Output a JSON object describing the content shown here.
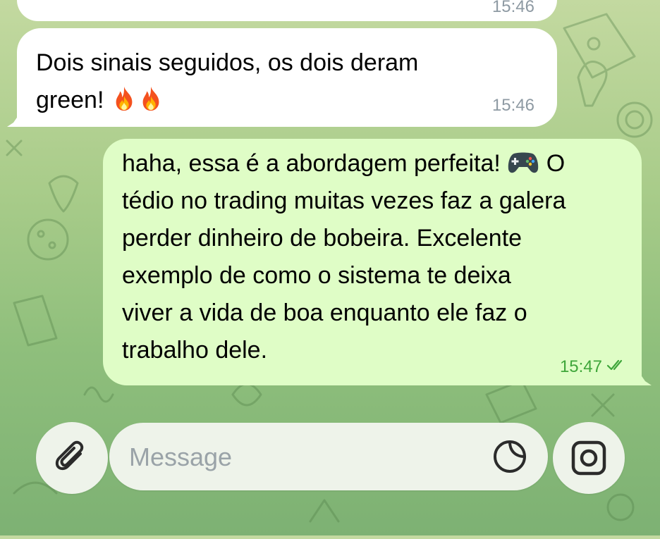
{
  "chat": {
    "messages": [
      {
        "direction": "incoming",
        "text": "",
        "time": "15:46"
      },
      {
        "direction": "incoming",
        "line1": "Dois sinais seguidos, os dois deram",
        "line2": "green!",
        "emojis": [
          "fire",
          "fire"
        ],
        "time": "15:46"
      },
      {
        "direction": "outgoing",
        "lines": [
          "haha, essa é a abordagem perfeita!",
          "O",
          "tédio no trading muitas vezes faz a galera",
          "perder dinheiro de bobeira. Excelente",
          "exemplo de como o sistema te deixa",
          "viver a vida de boa enquanto ele faz o",
          "trabalho dele."
        ],
        "emoji": "video-game-controller",
        "time": "15:47",
        "status": "read"
      }
    ]
  },
  "composer": {
    "placeholder": "Message",
    "value": ""
  },
  "colors": {
    "incoming_bubble": "#ffffff",
    "outgoing_bubble": "#dffdc6",
    "outgoing_time": "#3fa63a",
    "incoming_time": "#8e9aa3",
    "wallpaper": "#a9cc8a"
  },
  "icons": {
    "attach": "paperclip-icon",
    "sticker": "sticker-icon",
    "camera": "camera-icon",
    "read": "double-check-icon",
    "fire": "fire-emoji",
    "controller": "video-game-controller-emoji"
  }
}
